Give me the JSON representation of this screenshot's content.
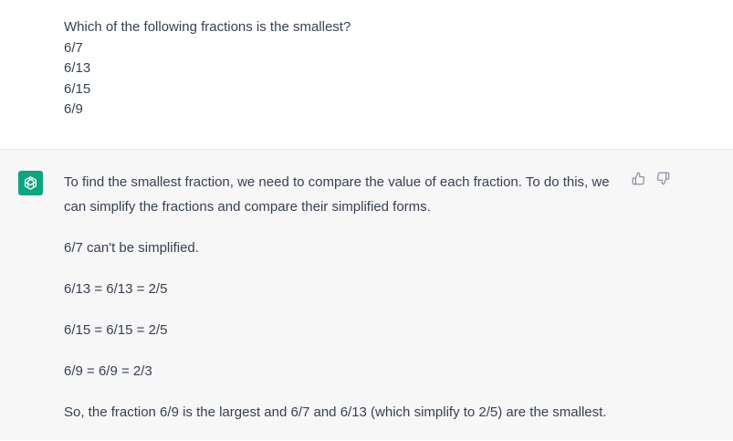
{
  "user_message": {
    "lines": [
      "Which of the following fractions is the smallest?",
      "6/7",
      "6/13",
      "6/15",
      "6/9"
    ]
  },
  "assistant_message": {
    "paragraphs": [
      "To find the smallest fraction, we need to compare the value of each fraction. To do this, we can simplify the fractions and compare their simplified forms.",
      "6/7 can't be simplified.",
      "6/13 = 6/13 = 2/5",
      "6/15 = 6/15 = 2/5",
      "6/9 = 6/9 = 2/3",
      "So, the fraction 6/9 is the largest and 6/7 and 6/13 (which simplify to 2/5) are the smallest."
    ],
    "avatar_icon": "openai-logo-icon",
    "feedback": {
      "thumbs_up_icon": "thumbs-up-icon",
      "thumbs_down_icon": "thumbs-down-icon"
    }
  },
  "colors": {
    "assistant_bg": "#f7f7f8",
    "avatar_bg": "#10a37f",
    "text": "#374151",
    "icon": "#8e8ea0"
  }
}
